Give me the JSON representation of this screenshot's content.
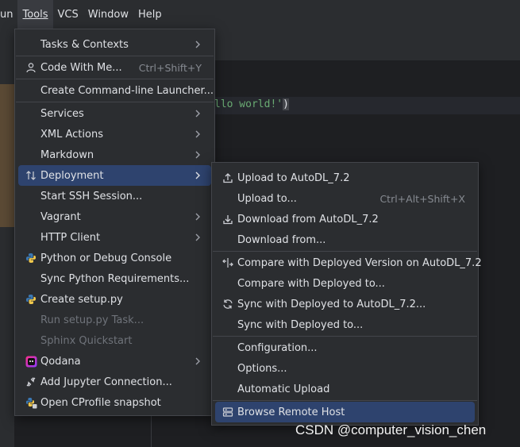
{
  "menubar": {
    "items": [
      {
        "label": "un"
      },
      {
        "label": "Tools"
      },
      {
        "label": "VCS"
      },
      {
        "label": "Window"
      },
      {
        "label": "Help"
      }
    ]
  },
  "editor": {
    "code_fragment": "llo world!'",
    "close_paren": ")"
  },
  "tools_menu": {
    "items": [
      {
        "label": "Tasks & Contexts"
      },
      {
        "label": "Code With Me...",
        "shortcut": "Ctrl+Shift+Y"
      },
      {
        "label": "Create Command-line Launcher..."
      },
      {
        "label": "Services"
      },
      {
        "label": "XML Actions"
      },
      {
        "label": "Markdown"
      },
      {
        "label": "Deployment"
      },
      {
        "label": "Start SSH Session..."
      },
      {
        "label": "Vagrant"
      },
      {
        "label": "HTTP Client"
      },
      {
        "label": "Python or Debug Console"
      },
      {
        "label": "Sync Python Requirements..."
      },
      {
        "label": "Create setup.py"
      },
      {
        "label": "Run setup.py Task..."
      },
      {
        "label": "Sphinx Quickstart"
      },
      {
        "label": "Qodana"
      },
      {
        "label": "Add Jupyter Connection..."
      },
      {
        "label": "Open CProfile snapshot"
      }
    ]
  },
  "deployment_menu": {
    "items": [
      {
        "label": "Upload to AutoDL_7.2"
      },
      {
        "label": "Upload to...",
        "shortcut": "Ctrl+Alt+Shift+X"
      },
      {
        "label": "Download from AutoDL_7.2"
      },
      {
        "label": "Download from..."
      },
      {
        "label": "Compare with Deployed Version on AutoDL_7.2"
      },
      {
        "label": "Compare with Deployed to..."
      },
      {
        "label": "Sync with Deployed to AutoDL_7.2..."
      },
      {
        "label": "Sync with Deployed to..."
      },
      {
        "label": "Configuration..."
      },
      {
        "label": "Options..."
      },
      {
        "label": "Automatic Upload"
      },
      {
        "label": "Browse Remote Host"
      }
    ]
  },
  "watermark": "CSDN @computer_vision_chen",
  "colors": {
    "menu_bg": "#2b2d30",
    "highlight": "#2e436e",
    "disabled_text": "#6f737a",
    "shortcut_text": "#868a91"
  }
}
